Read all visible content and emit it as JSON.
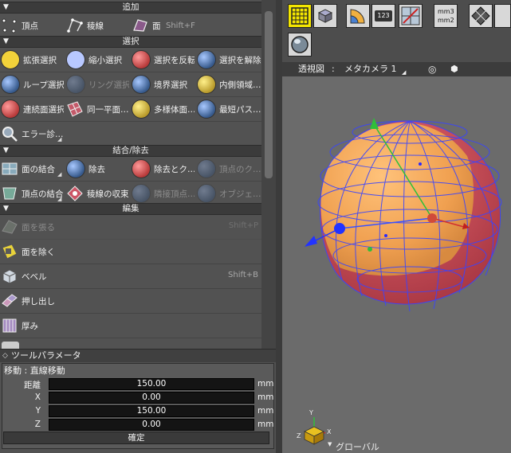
{
  "left_panel": {
    "sections": {
      "add": "追加",
      "select": "選択",
      "merge": "結合/除去",
      "edit": "編集"
    },
    "add_row": {
      "vertex": "頂点",
      "edge": "稜線",
      "face": "面",
      "face_shortcut": "Shift+F"
    },
    "select_rows": {
      "grow": "拡張選択",
      "shrink": "縮小選択",
      "invert": "選択を反転",
      "deselect": "選択を解除",
      "loop": "ループ選択",
      "ring": "リング選択",
      "boundary": "境界選択",
      "inner": "内側領域…",
      "connected": "連続面選択",
      "coplanar": "同一平面…",
      "polyhedron": "多様体面…",
      "shortest": "最短パス…",
      "error": "エラー診…"
    },
    "merge_rows": {
      "face_merge": "面の結合",
      "remove": "除去",
      "remove_clean": "除去とク…",
      "vertex_clean": "頂点のク…",
      "vertex_merge": "頂点の結合",
      "edge_collapse": "稜線の収束",
      "adjacent_vertex": "隣接頂点…",
      "object": "オブジェ…"
    },
    "edit_rows": [
      {
        "label": "面を張る",
        "shortcut": "Shift+P",
        "disabled": true
      },
      {
        "label": "面を除く",
        "shortcut": "",
        "disabled": false
      },
      {
        "label": "ベベル",
        "shortcut": "Shift+B",
        "disabled": false
      },
      {
        "label": "押し出し",
        "shortcut": "",
        "disabled": false
      },
      {
        "label": "厚み",
        "shortcut": "",
        "disabled": false
      }
    ]
  },
  "tool_params": {
    "title": "ツールパラメータ",
    "mode": "移動 : 直線移動",
    "fields": [
      {
        "label": "距離",
        "value": "150.00",
        "unit": "mm"
      },
      {
        "label": "X",
        "value": "0.00",
        "unit": "mm"
      },
      {
        "label": "Y",
        "value": "150.00",
        "unit": "mm"
      },
      {
        "label": "Z",
        "value": "0.00",
        "unit": "mm"
      }
    ],
    "confirm": "確定"
  },
  "toolbar": {
    "units_top": "mm3",
    "units_bottom": "mm2",
    "count_label": "123"
  },
  "viewport": {
    "view_label": "透視図",
    "separator": ":",
    "camera": "メタカメラ 1",
    "axis_x": "X",
    "axis_y": "Y",
    "axis_z": "Z",
    "coord_mode": "グローバル"
  },
  "colors": {
    "model_orange": "#f0a858",
    "model_red": "#e06068",
    "wire_blue": "#3040ff",
    "active_tool": "#f4e600"
  }
}
